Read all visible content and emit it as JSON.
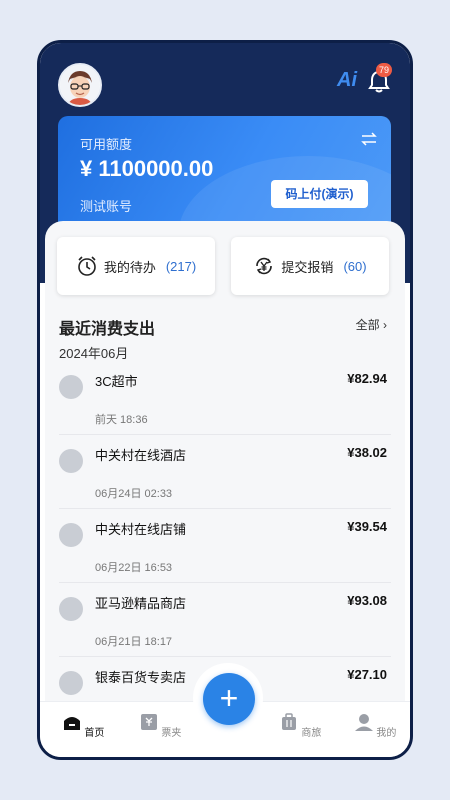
{
  "header": {
    "ai_label": "Ai",
    "notification_count": "79"
  },
  "balance_card": {
    "label": "可用额度",
    "amount": "¥ 1100000.00",
    "account_name": "测试账号",
    "pay_button": "码上付(演示)"
  },
  "quick_actions": [
    {
      "label": "我的待办",
      "count": "(217)",
      "icon": "alarm-clock-icon"
    },
    {
      "label": "提交报销",
      "count": "(60)",
      "icon": "yen-refresh-icon"
    }
  ],
  "recent": {
    "title": "最近消费支出",
    "see_all": "全部 ›",
    "month": "2024年06月"
  },
  "transactions": [
    {
      "name": "3C超市",
      "amount": "¥82.94",
      "time": "前天 18:36"
    },
    {
      "name": "中关村在线酒店",
      "amount": "¥38.02",
      "time": "06月24日 02:33"
    },
    {
      "name": "中关村在线店铺",
      "amount": "¥39.54",
      "time": "06月22日 16:53"
    },
    {
      "name": "亚马逊精品商店",
      "amount": "¥93.08",
      "time": "06月21日 18:17"
    },
    {
      "name": "银泰百货专卖店",
      "amount": "¥27.10",
      "time": ""
    }
  ],
  "tabbar": {
    "home": "首页",
    "tickets": "票夹",
    "add": "+",
    "travel": "商旅",
    "me": "我的"
  },
  "colors": {
    "header_bg": "#152a5a",
    "accent": "#2a83e6",
    "badge": "#ee5b44"
  }
}
